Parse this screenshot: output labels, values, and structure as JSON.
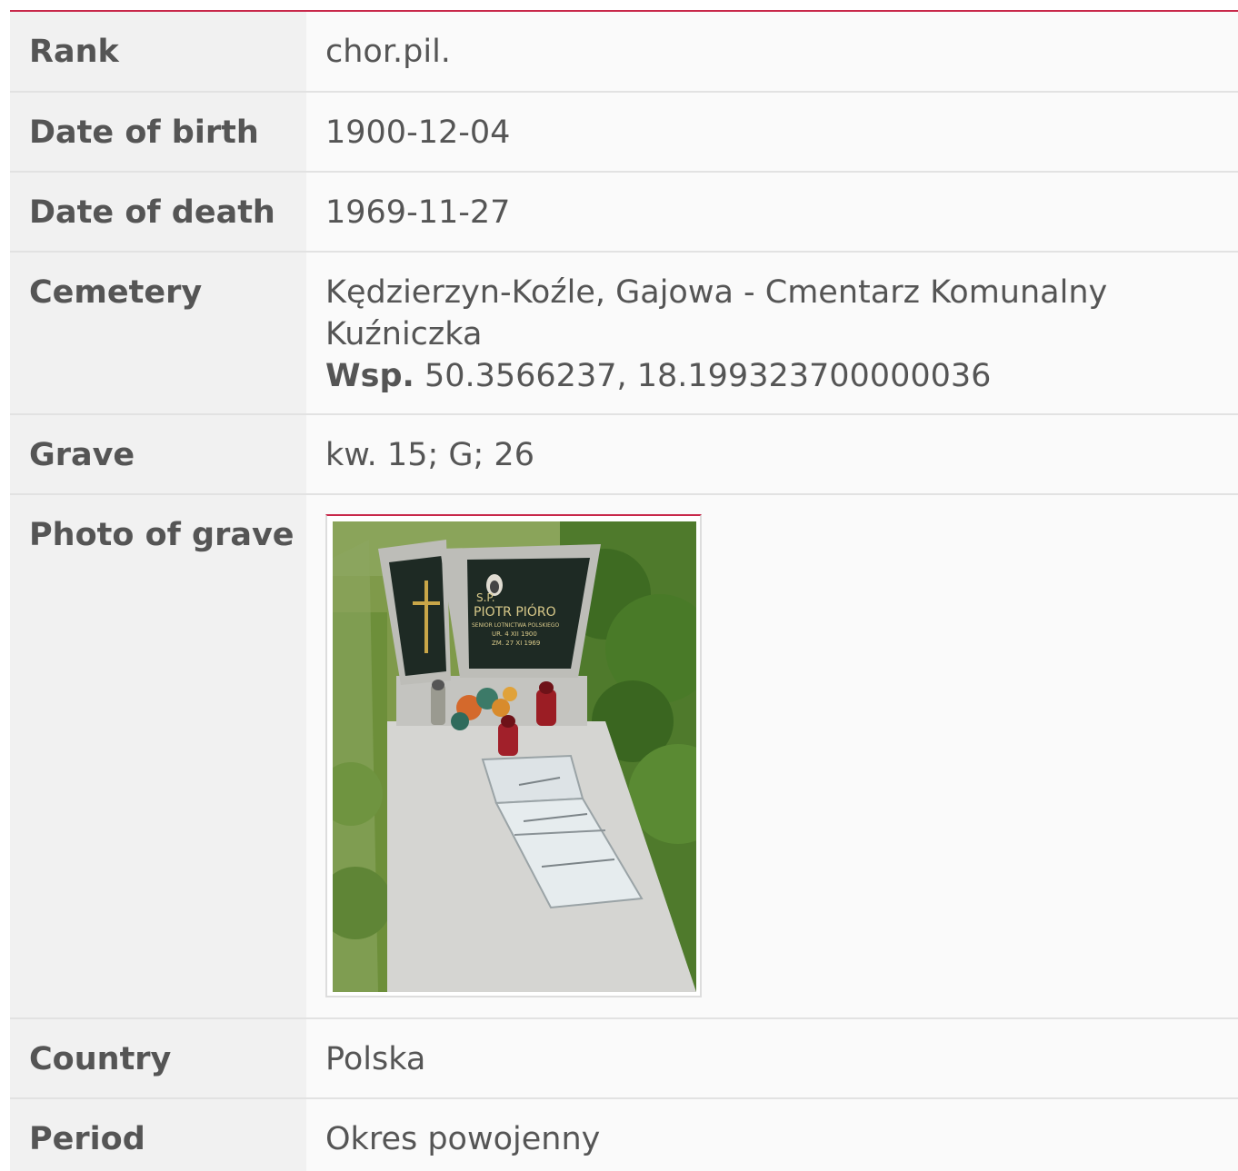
{
  "rows": {
    "rank": {
      "label": "Rank",
      "value": "chor.pil."
    },
    "birth": {
      "label": "Date of birth",
      "value": "1900-12-04"
    },
    "death": {
      "label": "Date of death",
      "value": "1969-11-27"
    },
    "cemetery": {
      "label": "Cemetery",
      "value": "Kędzierzyn-Koźle, Gajowa - Cmentarz Komunalny Kuźniczka",
      "coords_label": "Wsp.",
      "coords": "50.3566237, 18.199323700000036"
    },
    "grave": {
      "label": "Grave",
      "value": "kw. 15; G; 26"
    },
    "photo": {
      "label": "Photo of grave",
      "inscription_line1": "S.P.",
      "inscription_line2": "PIOTR PIÓRO",
      "inscription_line3": "SENIOR LOTNICTWA POLSKIEGO",
      "inscription_line4": "UR. 4 XII 1900",
      "inscription_line5": "ZM. 27 XI 1969"
    },
    "country": {
      "label": "Country",
      "value": "Polska"
    },
    "period": {
      "label": "Period",
      "value": "Okres powojenny"
    }
  },
  "colors": {
    "accent": "#c8284a",
    "label_bg": "#f1f1f1",
    "value_bg": "#fafafa",
    "text": "#555555"
  }
}
